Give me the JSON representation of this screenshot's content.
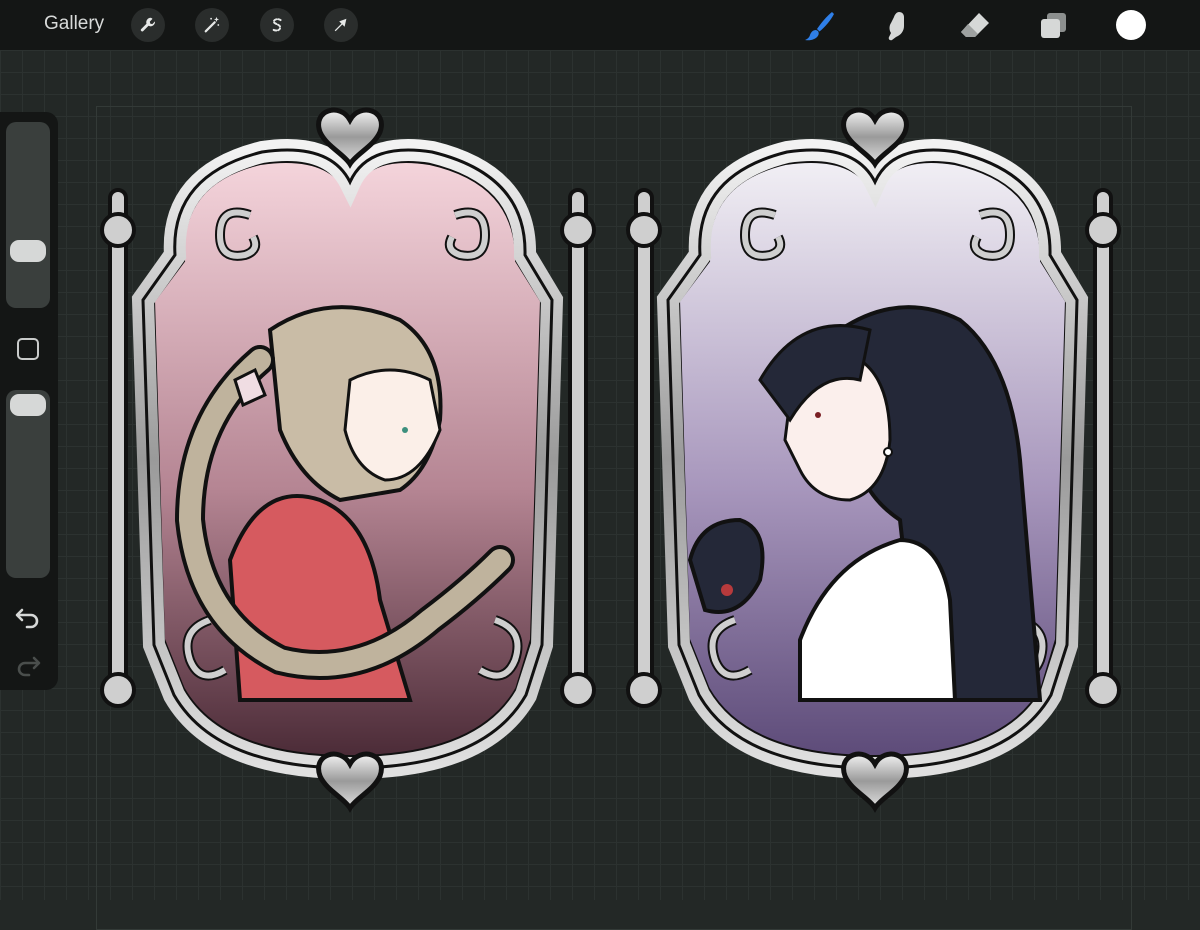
{
  "toolbar": {
    "gallery_label": "Gallery",
    "left_tools": [
      "wrench-icon",
      "magic-wand-icon",
      "selection-s-icon",
      "transform-arrow-icon"
    ],
    "right_tools": [
      "brush-icon",
      "smudge-icon",
      "eraser-icon",
      "layers-icon"
    ],
    "active_tool": "brush",
    "active_color": "#ffffff",
    "accent": "#2f7fe8"
  },
  "sidebar": {
    "brush_size_level": 0.35,
    "opacity_level": 0.95,
    "tools": [
      "modify-square-icon",
      "undo-icon",
      "redo-icon"
    ]
  },
  "canvas": {
    "frames": [
      {
        "subject": "portrait-braid-pink",
        "background_top": "#f5d5dc",
        "background_bottom": "#4a2a36",
        "dress_color": "#d65a5f"
      },
      {
        "subject": "portrait-black-hair-purple",
        "background_top": "#f2f0f5",
        "background_bottom": "#5c4a78",
        "top_color": "#ffffff"
      }
    ]
  }
}
